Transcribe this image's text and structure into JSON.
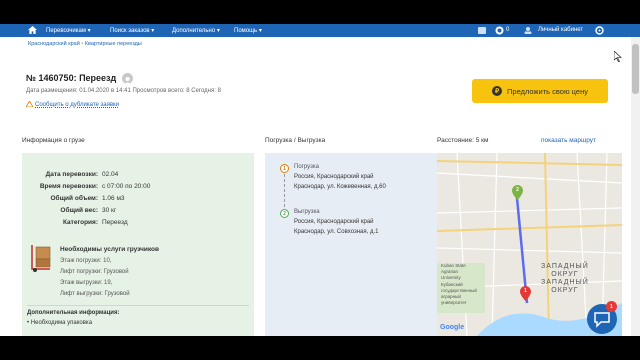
{
  "nav": {
    "items": [
      "Перевозчикам ▾",
      "Поиск заказов ▾",
      "Дополнительно ▾",
      "Помощь ▾"
    ],
    "count": "0",
    "account": "Личный кабинет"
  },
  "breadcrumb": [
    "Краснодарский край",
    "Квартирные переезды"
  ],
  "order": {
    "title": "№ 1460750: Переезд",
    "meta": "Дата размещения: 01.04.2020 в 14:41 Просмотров всего: 8 Сегодня: 8",
    "report_link": "Сообщить о дубликате заявки"
  },
  "offer_button": "Предложить свою цену",
  "sections": {
    "cargo": "Информация о грузе",
    "route": "Погрузка / Выгрузка",
    "distance": "Расстояние: 5 км",
    "route_link": "показать маршрут"
  },
  "cargo": {
    "rows": [
      {
        "label": "Дата перевозки:",
        "value": "02.04"
      },
      {
        "label": "Время перевозки:",
        "value": "с 07:00 по 20:00"
      },
      {
        "label": "Общий объем:",
        "value": "1.06 м3"
      },
      {
        "label": "Общий вес:",
        "value": "30 кг"
      },
      {
        "label": "Категория:",
        "value": "Переезд"
      }
    ],
    "services_title": "Необходимы услуги грузчиков",
    "services": [
      "Этаж погрузки: 10,",
      "Лифт погрузки: Грузовой",
      "Этаж выгрузки: 19,",
      "Лифт выгрузки: Грузовой"
    ],
    "additional_title": "Дополнительная информация:",
    "additional": "• Необходима упаковка"
  },
  "route": {
    "stops": [
      {
        "badge": "1",
        "title": "Погрузка",
        "lines": [
          "Россия, Краснодарский край",
          "Краснодар, ул. Кожевенная, д.60"
        ]
      },
      {
        "badge": "2",
        "title": "Выгрузка",
        "lines": [
          "Россия, Краснодарский край",
          "Краснодар, ул. Совхозная, д.1"
        ]
      }
    ]
  },
  "map": {
    "labels": [
      "Kuban State",
      "Agrarian",
      "University",
      "Кубанский",
      "государственный",
      "аграрный",
      "университет"
    ],
    "district_lines": [
      "ЗАПАДНЫЙ",
      "ОКРУГ",
      "ЗАПАДНЫЙ",
      "ОКРУГ"
    ],
    "pin_labels": [
      "2",
      "1"
    ],
    "logo": "Google"
  },
  "chat_badge": "1",
  "colors": {
    "nav": "#1f65b5",
    "accent_yellow": "#f8c30f",
    "cargo_bg": "#e6f2e6",
    "route_bg": "#e7edf5",
    "pin_green": "#7cb342",
    "pin_red": "#e53935",
    "route_line": "#5b6cf0"
  }
}
